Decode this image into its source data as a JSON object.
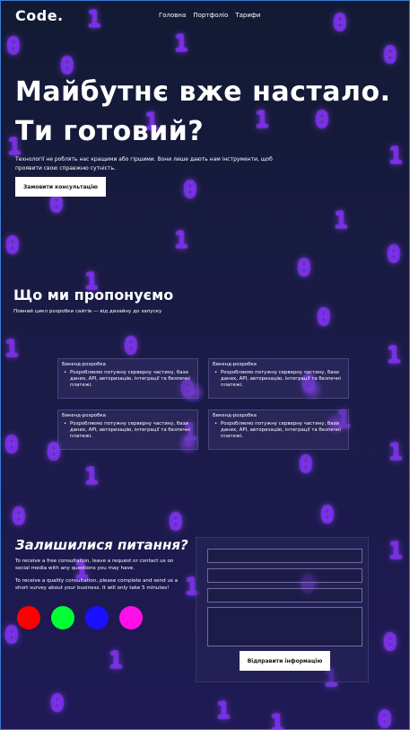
{
  "header": {
    "logo": "Code.",
    "nav": [
      "Головна",
      "Портфоліо",
      "Тарифи"
    ]
  },
  "hero": {
    "title_line1": "Майбутнє вже настало.",
    "title_line2": "Ти готовий?",
    "text": "Технології не роблять нас кращими або гіршими. Вони лише дають нам інструменти, щоб проявити свою справжню сутність.",
    "button": "Замовити консультацію"
  },
  "services": {
    "title": "Що ми пропонуємо",
    "subtitle": "Повний цикл розробки сайтів — від дизайну до запуску",
    "cards": [
      {
        "title": "Бекенд-розробка",
        "text": "Розробляємо потужну серверну частину, бази даних, API, авторизацію, інтеграції та безпечні платежі."
      },
      {
        "title": "Бекенд-розробка",
        "text": "Розробляємо потужну серверну частину, бази даних, API, авторизацію, інтеграції та безпечні платежі."
      },
      {
        "title": "Бекенд-розробка",
        "text": "Розробляємо потужну серверну частину, бази даних, API, авторизацію, інтеграції та безпечні платежі."
      },
      {
        "title": "Бекенд-розробка",
        "text": "Розробляємо потужну серверну частину, бази даних, API, авторизацію, інтеграції та безпечні платежі."
      }
    ]
  },
  "contact": {
    "title": "Залишилися питання?",
    "text1": "To receive a free consultation, leave a request or contact us on social media with any questions you may have.",
    "text2": "To receive a quality consultation, please complete and send us a short survey about your business. It will only take 5 minutes!",
    "social_colors": [
      "#ff0000",
      "#00ff33",
      "#1a10ff",
      "#ff10e8"
    ],
    "submit": "Відправити інформацію"
  },
  "background_digits": [
    "1",
    "0",
    "0",
    "1",
    "0",
    "0",
    "1",
    "0",
    "1",
    "1",
    "0",
    "0",
    "1",
    "0",
    "1",
    "0",
    "0",
    "1",
    "0",
    "0",
    "1",
    "1",
    "0",
    "0",
    "1",
    "1",
    "0",
    "1",
    "0",
    "0",
    "1",
    "0",
    "0",
    "1",
    "1",
    "0",
    "1",
    "0",
    "0",
    "1",
    "1",
    "0",
    "1",
    "0",
    "1",
    "1",
    "0"
  ],
  "colors": {
    "background": "#141a3a",
    "digit": "#7b2cf0",
    "button": "#ffffff"
  }
}
